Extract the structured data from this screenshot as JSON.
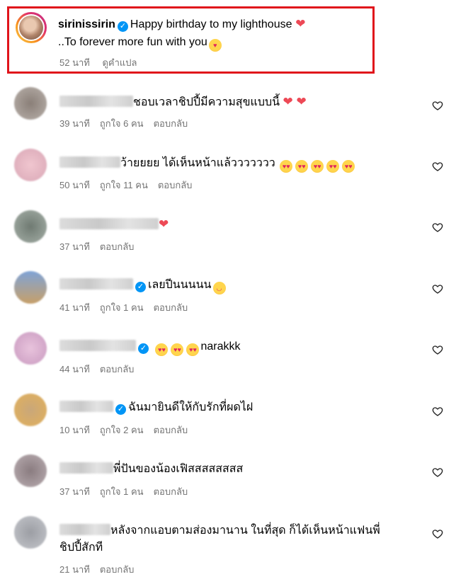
{
  "caption": {
    "username": "sirinissirin",
    "line1": "Happy birthday to my lighthouse",
    "line2": "..To forever more fun with you",
    "time": "52 นาที",
    "translate": "ดูคำแปล"
  },
  "comments": [
    {
      "text": "ชอบเวลาชิปปี้มีความสุขแบบนี้",
      "time": "39 นาที",
      "likes": "ถูกใจ 6 คน",
      "reply": "ตอบกลับ"
    },
    {
      "text": "ว้ายยยย ได้เห็นหน้าแล้ววววววว",
      "time": "50 นาที",
      "likes": "ถูกใจ 11 คน",
      "reply": "ตอบกลับ"
    },
    {
      "text": "",
      "time": "37 นาที",
      "reply": "ตอบกลับ"
    },
    {
      "text": "เลยปีนนนนน",
      "time": "41 นาที",
      "likes": "ถูกใจ 1 คน",
      "reply": "ตอบกลับ"
    },
    {
      "text": "narakkk",
      "time": "44 นาที",
      "reply": "ตอบกลับ"
    },
    {
      "text": "ฉันมายินดีให้กับรักที่ผดไฝ",
      "time": "10 นาที",
      "likes": "ถูกใจ 2 คน",
      "reply": "ตอบกลับ"
    },
    {
      "text": "พี่ปันของน้องเฟิสสสสสสสส",
      "time": "37 นาที",
      "likes": "ถูกใจ 1 คน",
      "reply": "ตอบกลับ"
    },
    {
      "text": "หลังจากแอบตามส่องมานาน ในที่สุด ก็ได้เห็นหน้าแฟนพี่",
      "text2": "ชิปปี้สักที",
      "time": "21 นาที",
      "reply": "ตอบกลับ"
    }
  ],
  "icons": {
    "like": "heart-outline-icon",
    "verified": "verified-badge-icon"
  },
  "colors": {
    "highlight_border": "#e0141b",
    "meta_text": "#737373",
    "verified": "#0095f6",
    "heart": "#ed4956"
  }
}
